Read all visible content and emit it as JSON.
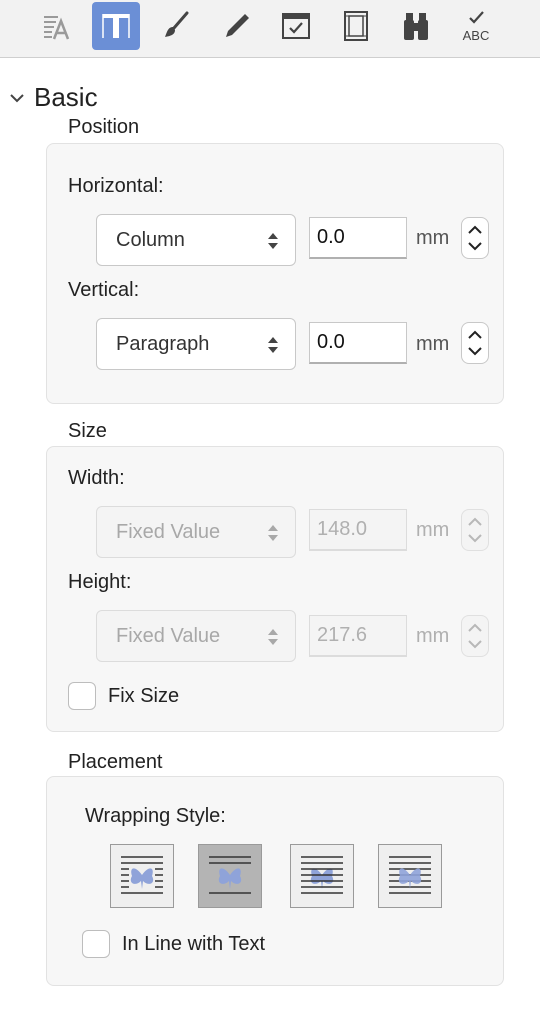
{
  "toolbar": {
    "tools": [
      {
        "name": "character-style-tool",
        "icon": "text-style-icon",
        "active": false
      },
      {
        "name": "paragraph-style-tool",
        "icon": "frame-position-icon",
        "active": true
      },
      {
        "name": "brush-tool",
        "icon": "brush-icon",
        "active": false
      },
      {
        "name": "pen-tool",
        "icon": "pen-icon",
        "active": false
      },
      {
        "name": "form-tool",
        "icon": "window-check-icon",
        "active": false
      },
      {
        "name": "frame-tool",
        "icon": "frame-icon",
        "active": false
      },
      {
        "name": "find-tool",
        "icon": "binoculars-icon",
        "active": false
      },
      {
        "name": "spellcheck-tool",
        "icon": "abc-check-icon",
        "active": false
      }
    ],
    "spell_text": "ABC"
  },
  "section": {
    "title": "Basic",
    "expanded": true
  },
  "position": {
    "label": "Position",
    "horizontal": {
      "label": "Horizontal:",
      "select_value": "Column",
      "number": "0.0",
      "unit": "mm"
    },
    "vertical": {
      "label": "Vertical:",
      "select_value": "Paragraph",
      "number": "0.0",
      "unit": "mm"
    }
  },
  "size": {
    "label": "Size",
    "width": {
      "label": "Width:",
      "select_value": "Fixed Value",
      "number": "148.0",
      "unit": "mm",
      "enabled": false
    },
    "height": {
      "label": "Height:",
      "select_value": "Fixed Value",
      "number": "217.6",
      "unit": "mm",
      "enabled": false
    },
    "fix_size": {
      "label": "Fix Size",
      "checked": false
    }
  },
  "placement": {
    "label": "Placement",
    "wrapping_label": "Wrapping Style:",
    "wrapping_options": [
      {
        "name": "wrap-square",
        "selected": false
      },
      {
        "name": "wrap-top-bottom",
        "selected": true
      },
      {
        "name": "wrap-behind-text",
        "selected": false
      },
      {
        "name": "wrap-in-front-of-text",
        "selected": false
      }
    ],
    "inline": {
      "label": "In Line with Text",
      "checked": false
    }
  },
  "colors": {
    "accent": "#6b8fd6",
    "butterfly": "#8fa3d9"
  }
}
